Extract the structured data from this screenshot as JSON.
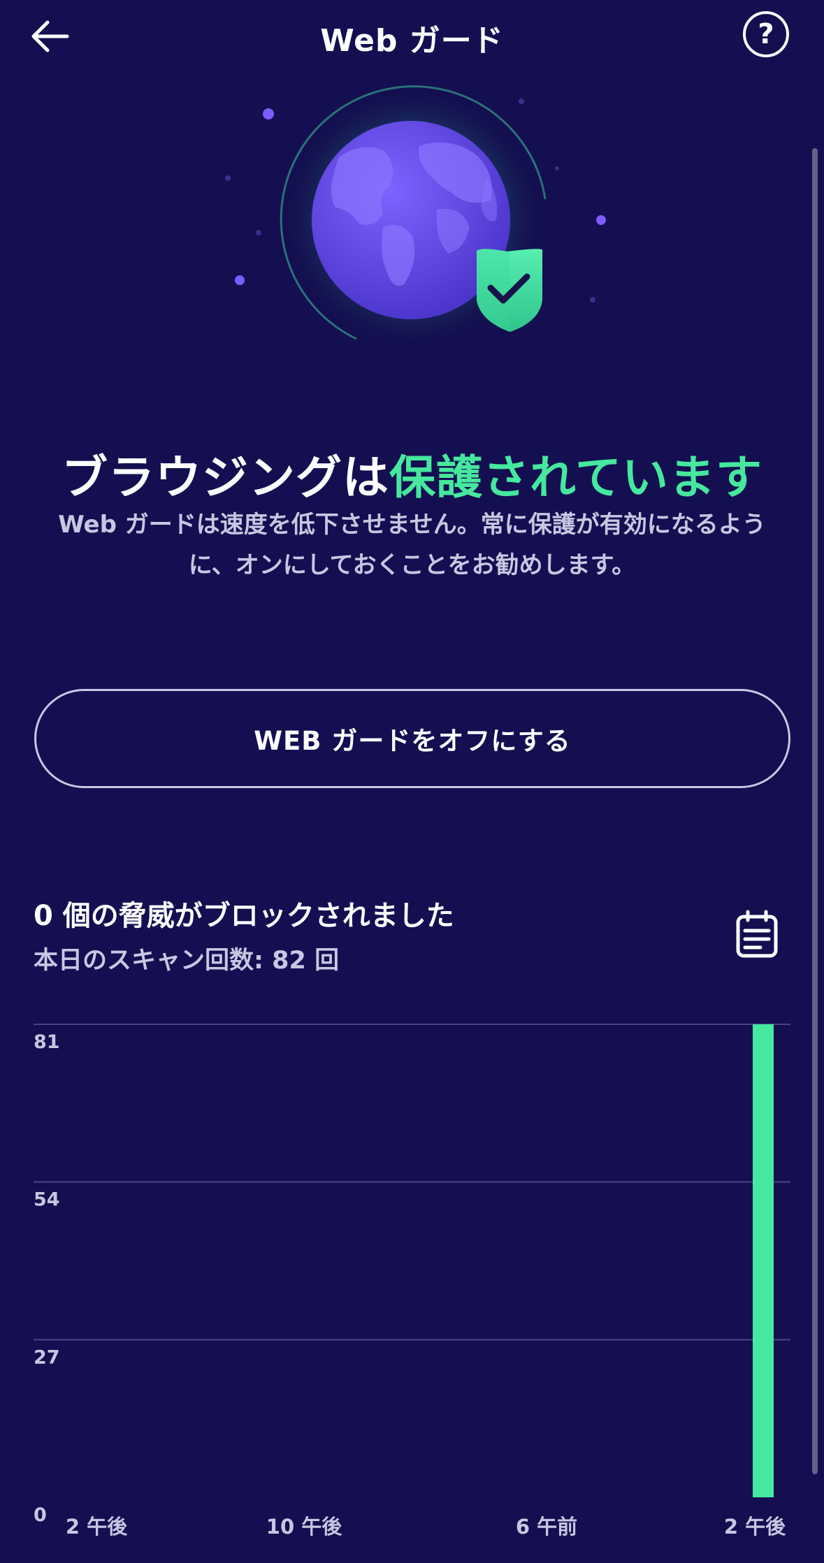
{
  "header": {
    "title": "Web ガード",
    "back_icon": "arrow-left-icon",
    "help_icon": "question-circle-icon",
    "help_glyph": "?"
  },
  "hero": {
    "image": "globe-with-shield-icon",
    "check_icon": "check-icon"
  },
  "status": {
    "title_prefix": "ブラウジングは",
    "title_accent": "保護されています",
    "description": "Web ガードは速度を低下させません。常に保護が有効になるように、オンにしておくことをお勧めします。"
  },
  "actions": {
    "turn_off_label": "WEB ガードをオフにする"
  },
  "stats": {
    "blocked_title": "0 個の脅威がブロックされました",
    "scan_count": "本日のスキャン回数: 82 回",
    "calendar_icon": "calendar-icon"
  },
  "colors": {
    "background": "#140f50",
    "accent": "#45e89e",
    "secondary_text": "#c9c6e3",
    "globe": "#6a4ff0"
  },
  "chart_data": {
    "type": "bar",
    "y_ticks": [
      "81",
      "54",
      "27",
      "0"
    ],
    "ylim": [
      0,
      81
    ],
    "x_tick_labels": [
      "2 午後",
      "10 午後",
      "6 午前",
      "2 午後"
    ],
    "bars": [
      {
        "position": "2 午後",
        "value": 81
      }
    ],
    "grid": true
  }
}
